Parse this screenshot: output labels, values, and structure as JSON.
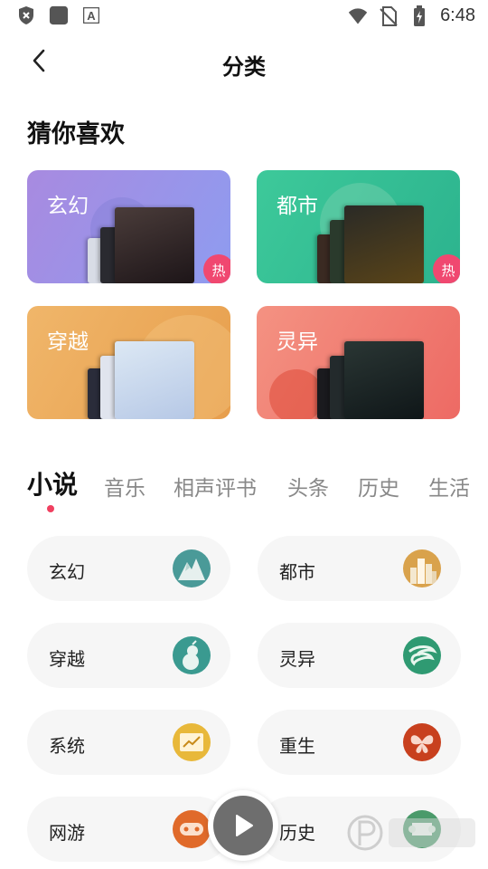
{
  "status_bar": {
    "time": "6:48",
    "icons_left": [
      "shield-x-icon",
      "app-square-icon",
      "font-a-icon"
    ],
    "icons_right": [
      "wifi-icon",
      "no-sim-icon",
      "battery-charging-icon"
    ]
  },
  "header": {
    "title": "分类",
    "back_icon": "chevron-left-icon"
  },
  "recommend": {
    "title": "猜你喜欢",
    "cards": [
      {
        "label": "玄幻",
        "badge": "热",
        "color_from": "#b08ee0",
        "color_to": "#8a9cf0"
      },
      {
        "label": "都市",
        "badge": "热",
        "color_from": "#3cc89a",
        "color_to": "#2fb590"
      },
      {
        "label": "穿越",
        "badge": "",
        "color_from": "#f0b060",
        "color_to": "#e89c48"
      },
      {
        "label": "灵异",
        "badge": "",
        "color_from": "#f28a7a",
        "color_to": "#ee6e66"
      }
    ]
  },
  "tabs": {
    "items": [
      "小说",
      "音乐",
      "相声评书",
      "头条",
      "历史",
      "生活"
    ],
    "active": "小说"
  },
  "subcategories": [
    {
      "label": "玄幻",
      "icon": "mountain-icon",
      "icon_color": "#4a9a98"
    },
    {
      "label": "都市",
      "icon": "city-buildings-icon",
      "icon_color": "#d9a24c"
    },
    {
      "label": "穿越",
      "icon": "gourd-icon",
      "icon_color": "#3a9a90"
    },
    {
      "label": "灵异",
      "icon": "swirl-icon",
      "icon_color": "#2f9a72"
    },
    {
      "label": "系统",
      "icon": "chart-screen-icon",
      "icon_color": "#e8b83a"
    },
    {
      "label": "重生",
      "icon": "butterfly-icon",
      "icon_color": "#c8401e"
    },
    {
      "label": "网游",
      "icon": "gamepad-icon",
      "icon_color": "#e06a2a"
    },
    {
      "label": "历史",
      "icon": "history-scroll-icon",
      "icon_color": "#4a9a6a"
    }
  ],
  "player": {
    "icon": "play-icon"
  },
  "watermark": {
    "icon": "p-logo-icon"
  }
}
